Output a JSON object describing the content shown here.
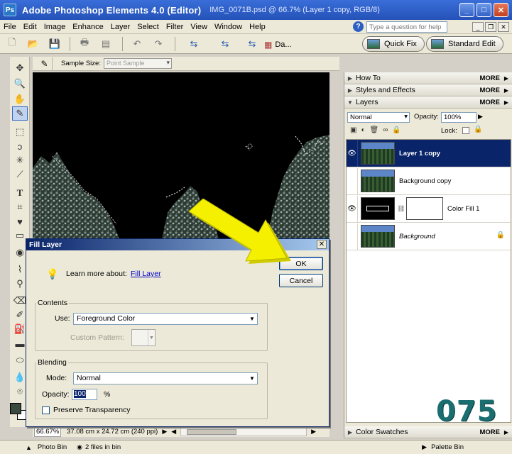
{
  "window": {
    "app_title": "Adobe Photoshop Elements 4.0 (Editor)",
    "doc_title": "IMG_0071B.psd @ 66.7% (Layer 1 copy, RGB/8)",
    "icon_letters": "Ps"
  },
  "menu": [
    "File",
    "Edit",
    "Image",
    "Enhance",
    "Layer",
    "Select",
    "Filter",
    "View",
    "Window",
    "Help"
  ],
  "help_search": {
    "placeholder": "Type a question for help"
  },
  "toolbar": {
    "da_label": "Da...",
    "quick_fix_label": "Quick Fix",
    "standard_edit_label": "Standard Edit"
  },
  "options": {
    "sample_size_label": "Sample Size:",
    "sample_size_value": "Point Sample"
  },
  "status": {
    "zoom": "66.67%",
    "doc_size": "37.08 cm x 24.72 cm (240 ppi)"
  },
  "bottom_bar": {
    "photo_bin_label": "Photo Bin",
    "file_count": "2 files in bin",
    "palette_bin_label": "Palette Bin"
  },
  "palettes": {
    "more_label": "MORE",
    "how_to": "How To",
    "styles_effects": "Styles and Effects",
    "layers": "Layers",
    "color_swatches": "Color Swatches"
  },
  "layers_panel": {
    "blend_mode": "Normal",
    "opacity_label": "Opacity:",
    "opacity_value": "100%",
    "lock_label": "Lock:",
    "layers": [
      {
        "name": "Layer 1 copy",
        "visible": true,
        "selected": true
      },
      {
        "name": "Background copy",
        "visible": false,
        "selected": false
      },
      {
        "name": "Color Fill 1",
        "visible": true,
        "selected": false
      },
      {
        "name": "Background",
        "visible": false,
        "selected": false
      }
    ]
  },
  "dialog": {
    "title": "Fill Layer",
    "learn_text": "Learn more about:",
    "learn_link": "Fill Layer",
    "ok_label": "OK",
    "cancel_label": "Cancel",
    "contents_label": "Contents",
    "use_label": "Use:",
    "use_value": "Foreground Color",
    "custom_pattern_label": "Custom Pattern:",
    "blending_label": "Blending",
    "mode_label": "Mode:",
    "mode_value": "Normal",
    "opacity_label": "Opacity:",
    "opacity_value": "100",
    "percent": "%",
    "preserve_label": "Preserve Transparency",
    "preserve_checked": false
  },
  "watermark": "075",
  "colors": {
    "titlebar": "#2452b8",
    "selection": "#0a246a",
    "arrow": "#f5f000",
    "watermark": "#1b6e70",
    "foreground_swatch": "#3b4a3f"
  }
}
